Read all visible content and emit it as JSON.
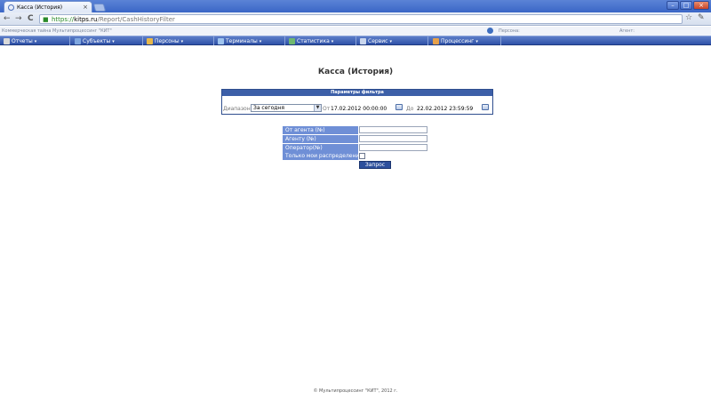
{
  "browser": {
    "tab_title": "Касса (История)",
    "tab_close": "×",
    "url_scheme": "https://",
    "url_host": "kitps.ru",
    "url_path": "/Report/CashHistoryFilter",
    "lock_icon": "lock-icon",
    "nav_back": "←",
    "nav_forward": "→",
    "nav_reload": "C",
    "star": "☆",
    "wrench": "✎",
    "win_min": "–",
    "win_max": "□",
    "win_close": "×"
  },
  "infobar": {
    "notice": "Коммерческая тайна Мультипроцессинг \"КИТ\"",
    "person_label": "Персона:",
    "agent_label": "Агент:"
  },
  "menu": {
    "arrow": "▾",
    "items": [
      {
        "label": "Отчеты",
        "icon": "reports-icon",
        "color": "#d9d9d9"
      },
      {
        "label": "Субъекты",
        "icon": "subjects-icon",
        "color": "#7fa7e0"
      },
      {
        "label": "Персоны",
        "icon": "persons-icon",
        "color": "#e8b84a"
      },
      {
        "label": "Терминалы",
        "icon": "terminals-icon",
        "color": "#9fc4ef"
      },
      {
        "label": "Статистика",
        "icon": "statistics-icon",
        "color": "#6fb86f"
      },
      {
        "label": "Сервис",
        "icon": "service-icon",
        "color": "#c9d6ee"
      },
      {
        "label": "Процессинг",
        "icon": "processing-icon",
        "color": "#e6a04a"
      }
    ]
  },
  "page": {
    "title": "Касса (История)"
  },
  "filter": {
    "header": "Параметры фильтра",
    "range_label": "Диапазон",
    "range_value": "За сегодня",
    "dd_arrow": "▼",
    "from_label": "От",
    "from_value": "17.02.2012 00:00:00",
    "to_label": "До",
    "to_value": "22.02.2012 23:59:59"
  },
  "form": {
    "fields": [
      {
        "label": "От агента (№)",
        "value": ""
      },
      {
        "label": "Агенту (№)",
        "value": ""
      },
      {
        "label": "Оператор(№)",
        "value": ""
      }
    ],
    "only_mine_label": "Только мои распределения",
    "only_mine_checked": false,
    "submit_label": "Запрос"
  },
  "footer": {
    "text": "© Мультипроцессинг \"КИТ\", 2012 г."
  },
  "colors": {
    "menu_bar": "#3c5fa8",
    "form_label": "#6f8fd6",
    "button": "#2c4f9c"
  }
}
